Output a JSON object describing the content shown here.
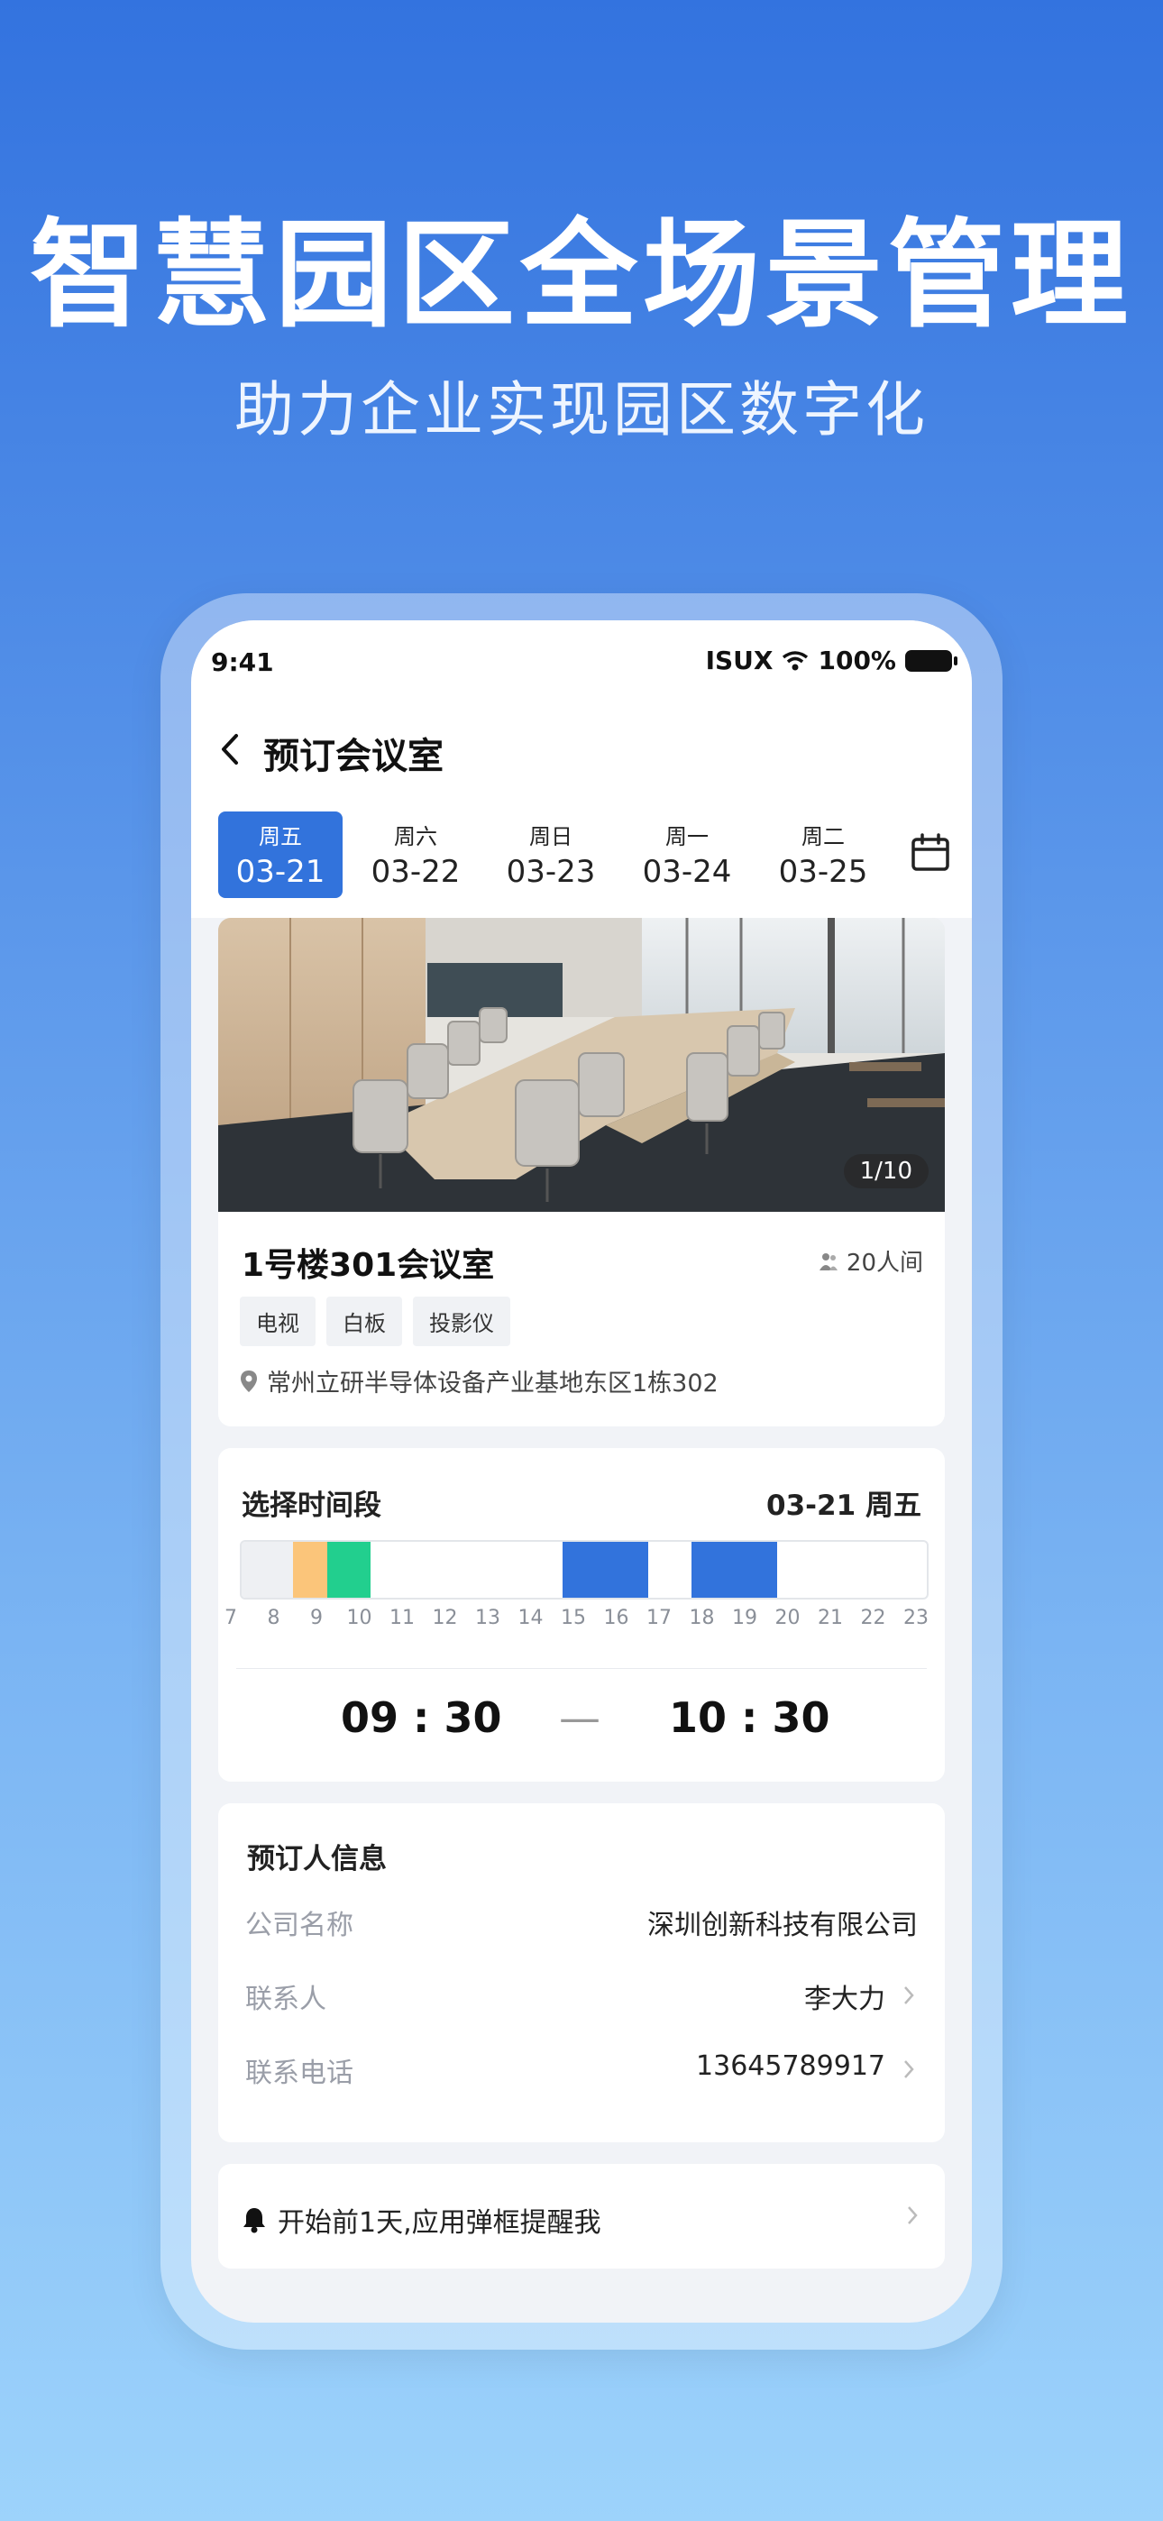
{
  "hero": {
    "title": "智慧园区全场景管理",
    "subtitle": "助力企业实现园区数字化"
  },
  "status_bar": {
    "time": "9:41",
    "carrier": "ISUX",
    "battery": "100%"
  },
  "nav": {
    "title": "预订会议室",
    "back_icon": "chevron-left-icon"
  },
  "dates": [
    {
      "weekday": "周五",
      "date": "03-21",
      "active": true
    },
    {
      "weekday": "周六",
      "date": "03-22",
      "active": false
    },
    {
      "weekday": "周日",
      "date": "03-23",
      "active": false
    },
    {
      "weekday": "周一",
      "date": "03-24",
      "active": false
    },
    {
      "weekday": "周二",
      "date": "03-25",
      "active": false
    }
  ],
  "room": {
    "photo_counter": "1/10",
    "name": "1号楼301会议室",
    "capacity": "20人间",
    "tags": [
      "电视",
      "白板",
      "投影仪"
    ],
    "address": "常州立研半导体设备产业基地东区1栋302"
  },
  "time_select": {
    "title": "选择时间段",
    "date_label": "03-21 周五",
    "hours": [
      "7",
      "8",
      "9",
      "10",
      "11",
      "12",
      "13",
      "14",
      "15",
      "16",
      "17",
      "18",
      "19",
      "20",
      "21",
      "22",
      "23"
    ],
    "start": "09 : 30",
    "separator": "—",
    "end": "10 : 30",
    "colors": {
      "past": "#eef0f3",
      "pending": "#fbc57a",
      "selected": "#22cf8e",
      "booked": "#3273dc"
    }
  },
  "booker": {
    "title": "预订人信息",
    "company_label": "公司名称",
    "company_value": "深圳创新科技有限公司",
    "contact_label": "联系人",
    "contact_value": "李大力",
    "phone_label": "联系电话",
    "phone_value": "13645789917"
  },
  "reminder": {
    "text": "开始前1天,应用弹框提醒我"
  }
}
